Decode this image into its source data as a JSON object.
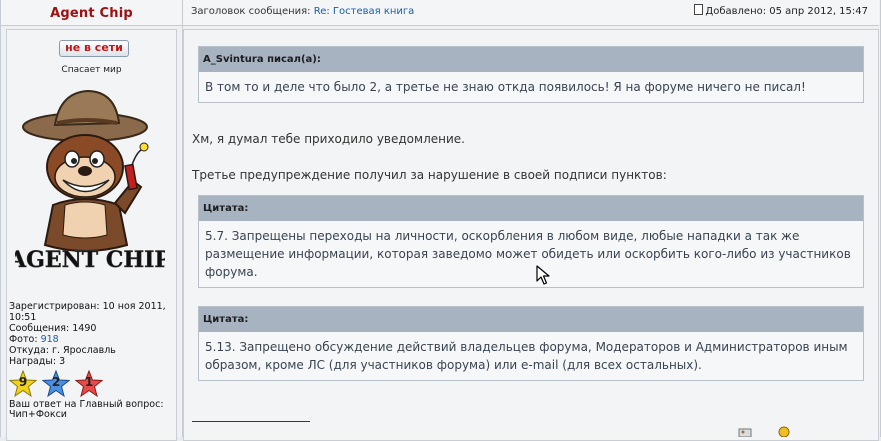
{
  "author": {
    "username": "Agent Chip",
    "status_badge": "не в сети",
    "user_title": "Спасает мир",
    "avatar_caption": "AGENT CHIP",
    "registered_label": "Зарегистрирован:",
    "registered_value": "10 ноя 2011, 10:51",
    "messages_label": "Сообщения:",
    "messages_value": "1490",
    "photos_label": "Фото:",
    "photos_value": "918",
    "from_label": "Откуда:",
    "from_value": "г. Ярославль",
    "awards_label": "Награды:",
    "awards_value": "3",
    "awards": [
      {
        "number": "9",
        "color": "#f2d21a"
      },
      {
        "number": "2",
        "color": "#4a8fe0"
      },
      {
        "number": "1",
        "color": "#e84a4a"
      }
    ],
    "answer_label": "Ваш ответ на Главный вопрос:",
    "answer_value": "Чип+Фокси"
  },
  "post": {
    "subject_label": "Заголовок сообщения:",
    "subject_value": "Re: Гостевая книга",
    "date": "Добавлено: 05 апр 2012, 15:47",
    "quote1": {
      "header": "A_Svintura писал(а):",
      "text": "В том то и деле что было 2, а третье не знаю откда появилось! Я на форуме ничего не писал!"
    },
    "paragraph1": "Хм, я думал тебе приходило уведомление.",
    "paragraph2": "Третье предупреждение получил за нарушение в своей подписи пунктов:",
    "quote2": {
      "header": "Цитата:",
      "text": "5.7. Запрещены переходы на личности, оскорбления в любом виде, любые нападки а так же размещение информации, которая заведомо может обидеть или оскорбить кого-либо из участников форума."
    },
    "quote3": {
      "header": "Цитата:",
      "text": "5.13. Запрещено обсуждение действий владельцев форума, Модераторов и Администраторов иным образом, кроме ЛС (для участников форума) или e-mail (для всех остальных)."
    }
  }
}
